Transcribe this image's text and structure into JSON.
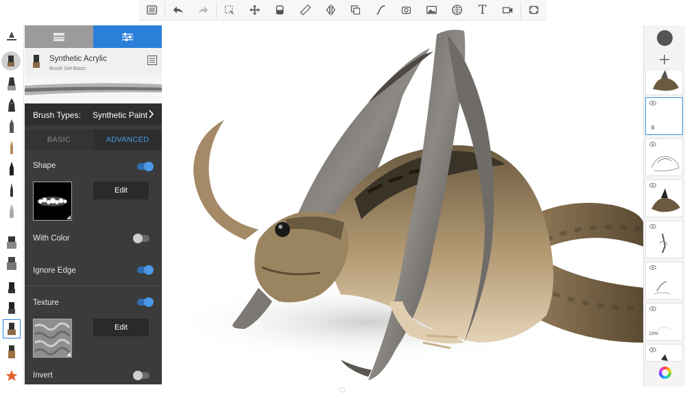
{
  "toolbar": {
    "items": [
      {
        "name": "layer-editor-icon"
      },
      {
        "name": "undo-icon"
      },
      {
        "name": "redo-icon"
      },
      {
        "name": "selection-icon"
      },
      {
        "name": "transform-icon"
      },
      {
        "name": "fill-icon"
      },
      {
        "name": "ruler-icon"
      },
      {
        "name": "symmetry-icon"
      },
      {
        "name": "stroke-icon"
      },
      {
        "name": "curve-icon"
      },
      {
        "name": "perspective-icon"
      },
      {
        "name": "image-icon"
      },
      {
        "name": "grid-icon"
      },
      {
        "name": "text-tool-icon"
      },
      {
        "name": "record-icon"
      },
      {
        "name": "fullscreen-icon"
      }
    ],
    "text_tool_glyph": "T"
  },
  "brush_panel": {
    "tabs": {
      "library_icon": "brush-library-icon",
      "settings_icon": "sliders-icon"
    },
    "active_tab_color": "#2b7fd9",
    "brush_name": "Synthetic Acrylic",
    "brush_set": "Brush Set:Basic",
    "brush_types_label": "Brush Types:",
    "brush_types_value": "Synthetic Paint",
    "mode_tabs": {
      "basic": "BASIC",
      "advanced": "ADVANCED"
    },
    "shape_label": "Shape",
    "shape_edit": "Edit",
    "with_color_label": "With Color",
    "ignore_edge_label": "Ignore Edge",
    "texture_label": "Texture",
    "texture_edit": "Edit",
    "invert_label": "Invert",
    "toggles": {
      "shape": true,
      "with_color": false,
      "ignore_edge": true,
      "texture": true,
      "invert": false
    }
  },
  "layers": {
    "add_icon": "plus-icon",
    "color_puck": "color-puck",
    "color_wheel_icon": "color-wheel-icon",
    "opacity_label": "19%",
    "selected_index": 1
  },
  "colors": {
    "accent": "#2b7fd9",
    "panel": "#3b3b3b",
    "toggle_on": "#4a98e6"
  }
}
